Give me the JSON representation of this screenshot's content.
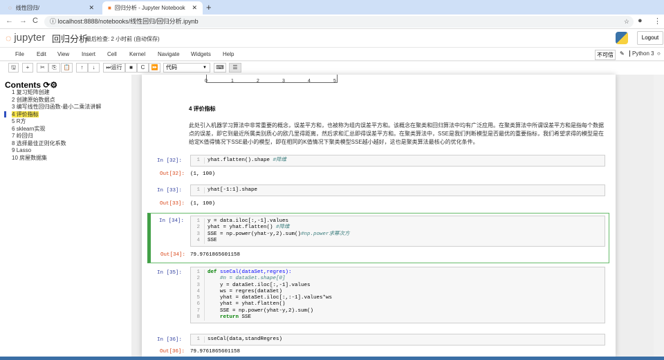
{
  "browser": {
    "tabs": [
      {
        "title": "线性回归/"
      },
      {
        "title": "回归分析 - Jupyter Notebook"
      }
    ],
    "url": "localhost:8888/notebooks/线性回归/回归分析.ipynb"
  },
  "header": {
    "logo": "jupyter",
    "title": "回归分析",
    "checkpoint": "最后检查: 2 小时前  (自动保存)",
    "logout": "Logout"
  },
  "menu": [
    "File",
    "Edit",
    "View",
    "Insert",
    "Cell",
    "Kernel",
    "Navigate",
    "Widgets",
    "Help"
  ],
  "status": {
    "trust": "不可信",
    "kernel": "Python 3"
  },
  "toolbar": {
    "run": "运行",
    "cell_type": "代码"
  },
  "toc": {
    "title": "Contents",
    "items": [
      {
        "n": "1",
        "t": "复习矩阵创建"
      },
      {
        "n": "2",
        "t": "创建原始数据点"
      },
      {
        "n": "3",
        "t": "编写线性回归函数-最小二乘法讲解"
      },
      {
        "n": "4",
        "t": "评价指标"
      },
      {
        "n": "5",
        "t": "R方"
      },
      {
        "n": "6",
        "t": "sklearn实现"
      },
      {
        "n": "7",
        "t": "岭回归"
      },
      {
        "n": "8",
        "t": "选择最佳正则化系数"
      },
      {
        "n": "9",
        "t": "Lasso"
      },
      {
        "n": "10",
        "t": "房屋数据集"
      }
    ]
  },
  "plot_ticks": [
    "0",
    "1",
    "2",
    "3",
    "4",
    "5"
  ],
  "section": {
    "heading": "4  评价指标",
    "text": "此处引入机器学习算法中非常重要的概念，误差平方和，也被称为组内误差平方和。该概念在聚类和回归算法中均有广泛应用。在聚类算法中所谓误差平方和是指每个数据点的误差，即它到最近所属类别质心的欧几里得距离，然后求和汇总即得误差平方和。在聚类算法中，SSE是我们判断模型是否最优的重要指标，我们希望求得的模型是在给定K值得情况下SSE最小的模型，即在相同的K值情况下聚类模型SSE越小越好，这也是聚类算法最核心的优化条件。"
  },
  "cells": {
    "c32": {
      "in": "In  [32]:",
      "code": "yhat.flatten().shape ",
      "comment": "#降维",
      "out_label": "Out[32]:",
      "out": "(1, 100)"
    },
    "c33": {
      "in": "In  [33]:",
      "code": "yhat[-1:1].shape",
      "out_label": "Out[33]:",
      "out": "(1, 100)"
    },
    "c34": {
      "in": "In  [34]:",
      "l1": "y = data.iloc[:,-1].values",
      "l2": "yhat = yhat.flatten() ",
      "l2c": "#降维",
      "l3": "SSE = np.power(yhat-y,2).sum()",
      "l3c": "#np.power求幂次方",
      "l4": "SSE",
      "out_label": "Out[34]:",
      "out": "79.9761865601158"
    },
    "c35": {
      "in": "In  [35]:",
      "l1a": "def ",
      "l1b": "sseCal(dataSet,regres):",
      "l2": "    #n = dataSet.shape[0]",
      "l3": "    y = dataSet.iloc[:,-1].values",
      "l4": "    ws = regres(dataSet)",
      "l5": "    yhat = dataSet.iloc[:,:-1].values*ws",
      "l6": "    yhat = yhat.flatten()",
      "l7": "    SSE = np.power(yhat-y,2).sum()",
      "l8a": "    return ",
      "l8b": "SSE"
    },
    "c36": {
      "in": "In  [36]:",
      "code": "sseCal(data,standRegres)",
      "out_label": "Out[36]:",
      "out": "79.9761865601158"
    }
  }
}
